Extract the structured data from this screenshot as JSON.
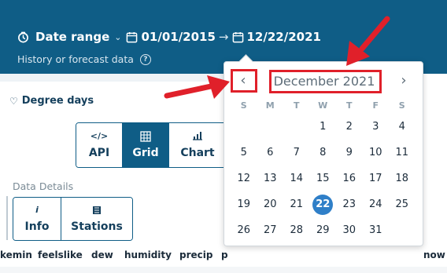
{
  "header": {
    "date_range_label": "Date range",
    "start_date": "01/01/2015",
    "end_date": "12/22/2021",
    "subtitle": "History or forecast data"
  },
  "sidebar": {
    "degree_days_label": "Degree days"
  },
  "view_buttons": [
    {
      "label": "API",
      "icon": "</>"
    },
    {
      "label": "Grid",
      "icon": "grid-icon"
    },
    {
      "label": "Chart",
      "icon": "chart-icon"
    }
  ],
  "data_details": {
    "label": "Data Details",
    "buttons": [
      {
        "label": "Info",
        "icon": "i"
      },
      {
        "label": "Stations",
        "icon": "stations-icon"
      }
    ]
  },
  "columns": [
    "kemin",
    "feelslike",
    "dew",
    "humidity",
    "precip",
    "p",
    "now"
  ],
  "calendar": {
    "month_label": "December 2021",
    "weekdays": [
      "S",
      "M",
      "T",
      "W",
      "T",
      "F",
      "S"
    ],
    "weeks": [
      [
        "",
        "",
        "",
        "1",
        "2",
        "3",
        "4"
      ],
      [
        "5",
        "6",
        "7",
        "8",
        "9",
        "10",
        "11"
      ],
      [
        "12",
        "13",
        "14",
        "15",
        "16",
        "17",
        "18"
      ],
      [
        "19",
        "20",
        "21",
        "22",
        "23",
        "24",
        "25"
      ],
      [
        "26",
        "27",
        "28",
        "29",
        "30",
        "31",
        ""
      ]
    ],
    "selected_day": "22"
  },
  "colors": {
    "header_bg": "#0f5d86",
    "selected_day": "#2f7fc8",
    "annotation": "#e0202a"
  }
}
